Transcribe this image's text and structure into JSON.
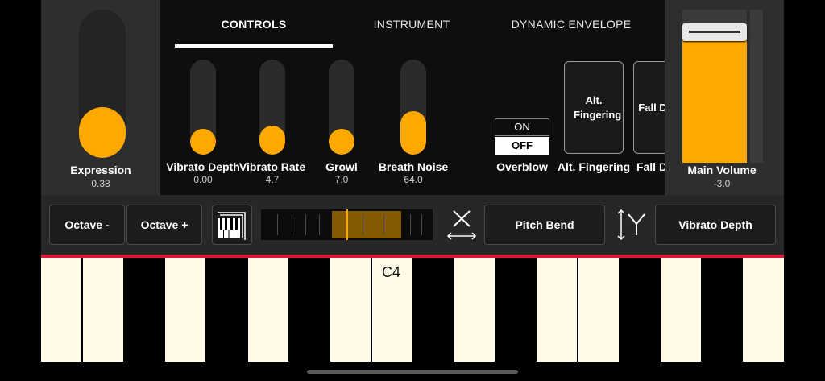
{
  "expression": {
    "label": "Expression",
    "value": "0.38",
    "level": 0.38
  },
  "tabs": [
    {
      "label": "CONTROLS",
      "active": true
    },
    {
      "label": "INSTRUMENT",
      "active": false
    },
    {
      "label": "DYNAMIC ENVELOPE",
      "active": false
    }
  ],
  "controls": [
    {
      "label": "Vibrato Depth",
      "value": "0.00",
      "level": 0.0
    },
    {
      "label": "Vibrato Rate",
      "value": "4.7",
      "level": 0.1
    },
    {
      "label": "Growl",
      "value": "7.0",
      "level": 0.0
    },
    {
      "label": "Breath Noise",
      "value": "64.0",
      "level": 0.5
    }
  ],
  "overblow": {
    "label": "Overblow",
    "on": "ON",
    "off": "OFF",
    "selected": "OFF"
  },
  "alt_fingering": {
    "button": "Alt. Fingering",
    "label": "Alt. Fingering"
  },
  "fall_down": {
    "button": "Fall Down",
    "label": "Fall Down"
  },
  "main_volume": {
    "label": "Main Volume",
    "value": "-3.0",
    "level": 0.85
  },
  "toolbar": {
    "octave_minus": "Octave -",
    "octave_plus": "Octave +",
    "x_axis": "Pitch Bend",
    "y_axis": "Vibrato Depth"
  },
  "keyboard": {
    "note_label": "C4"
  },
  "colors": {
    "accent": "#ffa800",
    "divider": "#d8193a"
  }
}
